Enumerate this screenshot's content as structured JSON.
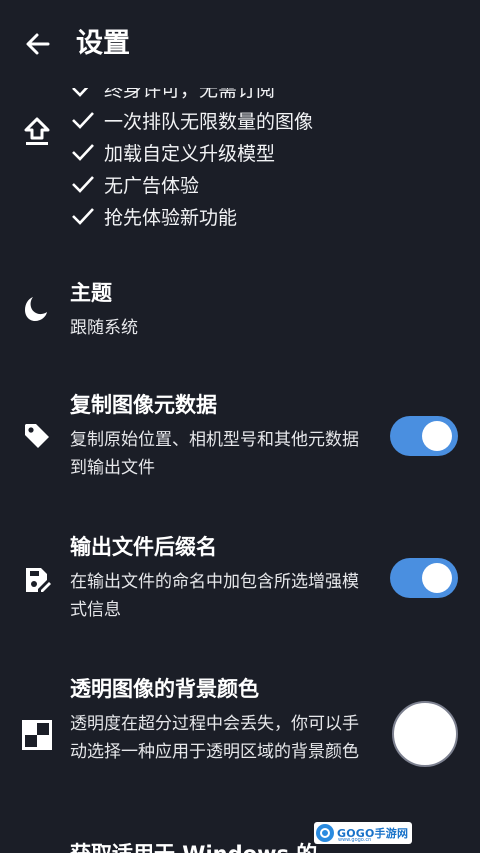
{
  "header": {
    "title": "设置"
  },
  "upgrade": {
    "features": [
      "终身许可，无需订阅",
      "一次排队无限数量的图像",
      "加载自定义升级模型",
      "无广告体验",
      "抢先体验新功能"
    ]
  },
  "settings": {
    "theme": {
      "title": "主题",
      "value": "跟随系统"
    },
    "copy_metadata": {
      "title": "复制图像元数据",
      "description": "复制原始位置、相机型号和其他元数据到输出文件",
      "enabled": true
    },
    "output_suffix": {
      "title": "输出文件后缀名",
      "description": "在输出文件的命名中加包含所选增强模式信息",
      "enabled": true
    },
    "transparent_bg": {
      "title": "透明图像的背景颜色",
      "description": "透明度在超分过程中会丢失，你可以手动选择一种应用于透明区域的背景颜色",
      "color": "#ffffff"
    },
    "next_partial": {
      "title": "获取适用于 Windows 的"
    }
  },
  "watermark": {
    "text": "GOGO手游网",
    "sub": "www.gogo.cn"
  },
  "colors": {
    "background": "#1b1e27",
    "accent": "#4a8fe0",
    "text": "#ffffff"
  }
}
